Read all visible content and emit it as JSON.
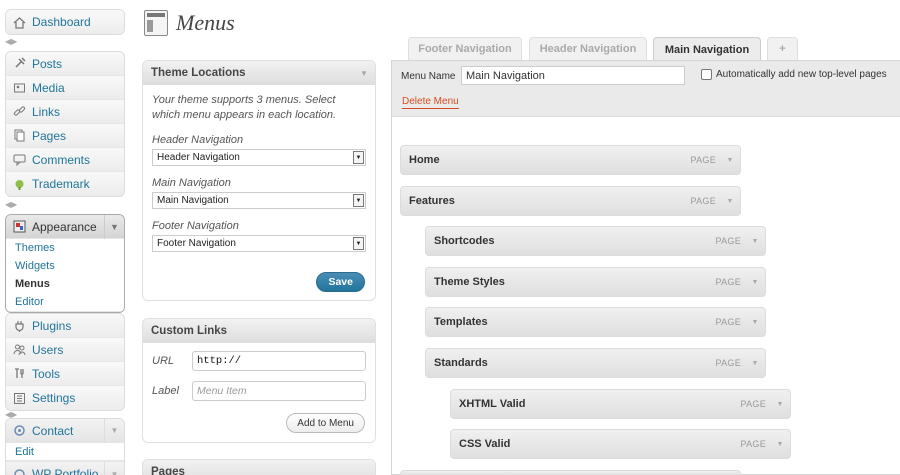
{
  "sidebar": {
    "group1": [
      {
        "label": "Dashboard",
        "icon": "dashboard-icon"
      }
    ],
    "group2": [
      {
        "label": "Posts",
        "icon": "pin-icon"
      },
      {
        "label": "Media",
        "icon": "media-icon"
      },
      {
        "label": "Links",
        "icon": "link-icon"
      },
      {
        "label": "Pages",
        "icon": "pages-icon"
      },
      {
        "label": "Comments",
        "icon": "comment-icon"
      },
      {
        "label": "Trademark",
        "icon": "trademark-icon"
      }
    ],
    "appearance": {
      "label": "Appearance",
      "icon": "appearance-icon",
      "submenu": [
        "Themes",
        "Widgets",
        "Menus",
        "Editor"
      ],
      "active_sub": "Menus"
    },
    "group4": [
      {
        "label": "Plugins",
        "icon": "plugin-icon"
      },
      {
        "label": "Users",
        "icon": "users-icon"
      },
      {
        "label": "Tools",
        "icon": "tools-icon"
      },
      {
        "label": "Settings",
        "icon": "settings-icon"
      }
    ],
    "contact": {
      "label": "Contact",
      "icon": "contact-icon",
      "sub": "Edit"
    },
    "portfolio": {
      "label": "WP Portfolio",
      "icon": "portfolio-icon"
    }
  },
  "page": {
    "title": "Menus"
  },
  "theme_locations": {
    "title": "Theme Locations",
    "intro": "Your theme supports 3 menus. Select which menu appears in each location.",
    "locations": [
      {
        "label": "Header Navigation",
        "value": "Header Navigation"
      },
      {
        "label": "Main Navigation",
        "value": "Main Navigation"
      },
      {
        "label": "Footer Navigation",
        "value": "Footer Navigation"
      }
    ],
    "save": "Save"
  },
  "custom_links": {
    "title": "Custom Links",
    "url_label": "URL",
    "url_value": "http://",
    "label_label": "Label",
    "label_placeholder": "Menu Item",
    "add": "Add to Menu"
  },
  "pages_box": {
    "title": "Pages"
  },
  "tabs": [
    {
      "label": "Footer Navigation"
    },
    {
      "label": "Header Navigation"
    },
    {
      "label": "Main Navigation"
    },
    {
      "label": "+"
    }
  ],
  "active_tab": "Main Navigation",
  "menu_editor": {
    "name_label": "Menu Name",
    "name_value": "Main Navigation",
    "auto_add": "Automatically add new top-level pages",
    "delete": "Delete Menu",
    "items": [
      {
        "title": "Home",
        "type": "PAGE",
        "depth": 0
      },
      {
        "title": "Features",
        "type": "PAGE",
        "depth": 0
      },
      {
        "title": "Shortcodes",
        "type": "PAGE",
        "depth": 1
      },
      {
        "title": "Theme Styles",
        "type": "PAGE",
        "depth": 1
      },
      {
        "title": "Templates",
        "type": "PAGE",
        "depth": 1
      },
      {
        "title": "Standards",
        "type": "PAGE",
        "depth": 1
      },
      {
        "title": "XHTML Valid",
        "type": "PAGE",
        "depth": 2
      },
      {
        "title": "CSS Valid",
        "type": "PAGE",
        "depth": 2
      }
    ]
  }
}
